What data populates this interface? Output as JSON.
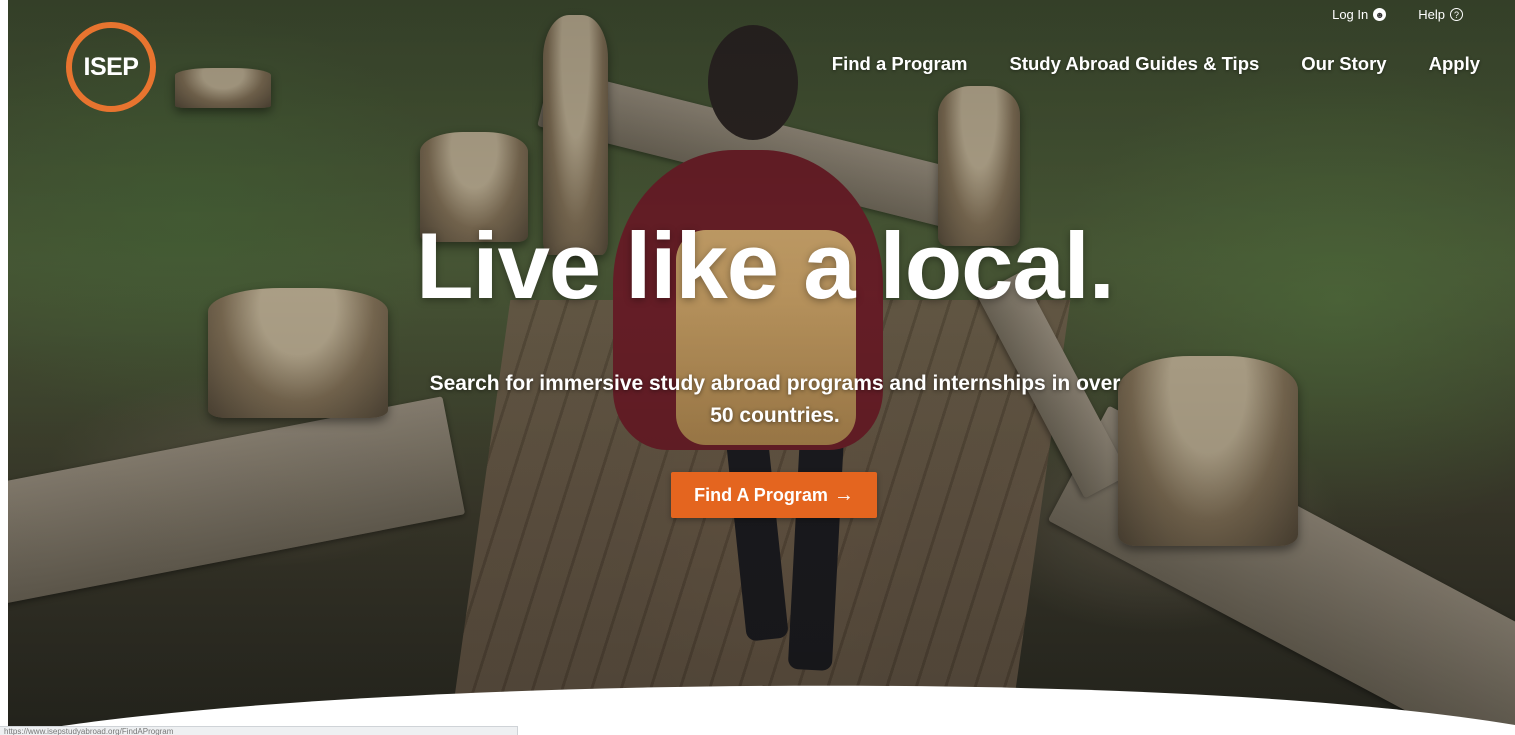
{
  "brand": {
    "logo_text": "ISEP",
    "accent_color": "#e8742f",
    "cta_color": "#e4651f"
  },
  "utility_nav": [
    {
      "label": "Log In",
      "icon": "user-circle-icon"
    },
    {
      "label": "Help",
      "icon": "question-circle-icon"
    }
  ],
  "main_nav": [
    {
      "label": "Find a Program"
    },
    {
      "label": "Study Abroad Guides & Tips"
    },
    {
      "label": "Our Story"
    },
    {
      "label": "Apply"
    }
  ],
  "hero": {
    "headline": "Live like a local.",
    "subtext": "Search for immersive study abroad programs and internships in over 50 countries.",
    "cta_label": "Find A Program",
    "cta_icon": "arrow-right-icon"
  },
  "status_bar": {
    "url": "https://www.isepstudyabroad.org/FindAProgram"
  }
}
